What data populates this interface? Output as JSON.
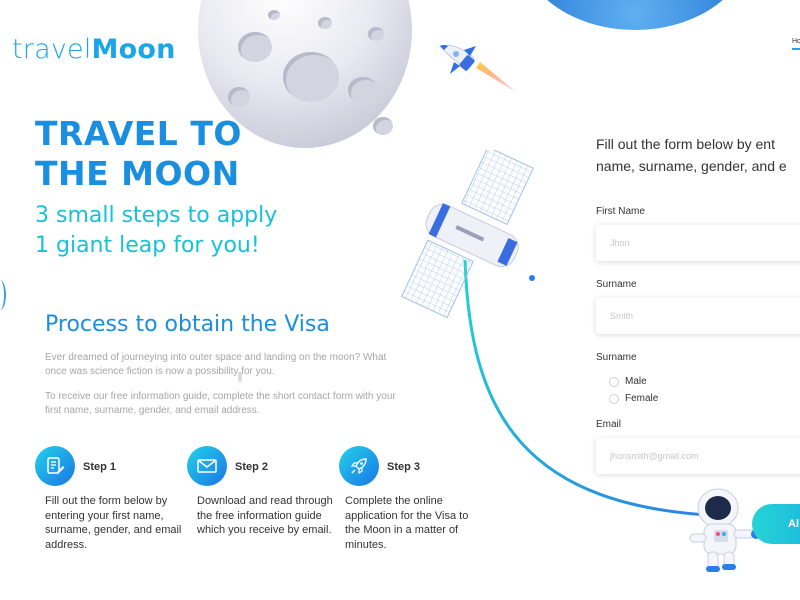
{
  "logo": {
    "light": "travel",
    "bold": "Moon"
  },
  "nav": {
    "home": "Ho"
  },
  "hero": {
    "title_line1": "TRAVEL TO",
    "title_line2": "THE MOON",
    "subtitle_line1": "3 small steps to apply",
    "subtitle_line2": "1 giant leap for you!"
  },
  "process": {
    "title": "Process to obtain the Visa",
    "paragraph1": "Ever dreamed of journeying into outer space and landing on the moon? What once was science fiction is now a possibility for you.",
    "paragraph2": "To receive our free information guide, complete the short contact form with your first name, surname, gender, and email address."
  },
  "steps": [
    {
      "label": "Step 1",
      "icon": "document-edit-icon",
      "text": "Fill out the form below by entering your first name, surname, gender, and email address."
    },
    {
      "label": "Step 2",
      "icon": "envelope-icon",
      "text": "Download and read through the free information guide which you receive by email."
    },
    {
      "label": "Step 3",
      "icon": "rocket-icon",
      "text": "Complete the online application for the Visa to the Moon in a matter of minutes."
    }
  ],
  "form": {
    "intro_line1": "Fill out the form below by ent",
    "intro_line2": "name, surname, gender, and e",
    "first_name_label": "First Name",
    "first_name_placeholder": "Jhon",
    "surname_label": "Surname",
    "surname_placeholder": "Smith",
    "gender_label": "Surname",
    "gender_options": [
      "Male",
      "Female"
    ],
    "email_label": "Email",
    "email_placeholder": "jhonsmith@gmail.com",
    "submit_label": "Al"
  },
  "colors": {
    "brand_blue": "#1a8fe0",
    "teal": "#16c2d6",
    "logo": "#1aa6e8"
  }
}
